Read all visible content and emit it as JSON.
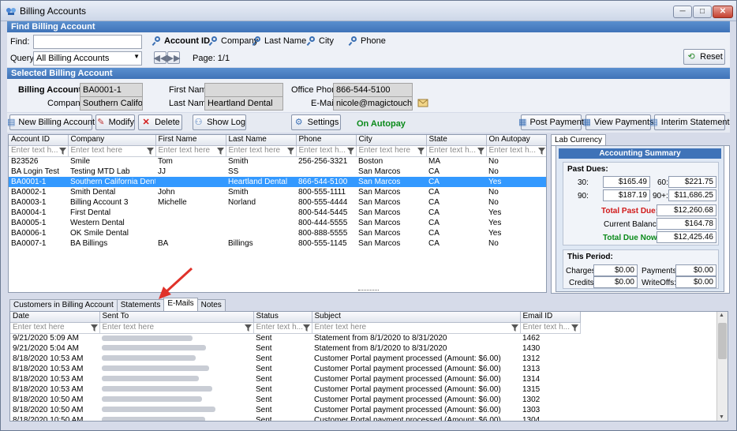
{
  "window": {
    "title": "Billing Accounts",
    "min": "─",
    "max": "□",
    "close": "✕"
  },
  "find": {
    "header": "Find Billing Account",
    "find_label": "Find:",
    "find_value": "",
    "radios": [
      "Account ID",
      "Company",
      "Last Name",
      "City",
      "Phone"
    ],
    "query_label": "Query:",
    "query_value": "All Billing Accounts",
    "page_label": "Page: 1/1",
    "reset": "Reset"
  },
  "selected": {
    "header": "Selected Billing Account",
    "id_label": "Billing Account ID:",
    "id": "BA0001-1",
    "company_label": "Company:",
    "company": "Southern California Dental Lab",
    "first_label": "First Name:",
    "first": "",
    "last_label": "Last Name:",
    "last": "Heartland Dental",
    "phone_label": "Office Phone:",
    "phone": "866-544-5100",
    "email_label": "E-Mail:",
    "email": "nicole@magictouchsoftware.com"
  },
  "toolbar": {
    "new": "New Billing Account",
    "modify": "Modify",
    "delete": "Delete",
    "showlog": "Show Log",
    "settings": "Settings",
    "autopay": "On Autopay",
    "post": "Post Payment",
    "view": "View Payments",
    "interim": "Interim Statement"
  },
  "accounts": {
    "columns": [
      "Account ID",
      "Company",
      "First Name",
      "Last Name",
      "Phone",
      "City",
      "State",
      "On Autopay"
    ],
    "filters": [
      "Enter text h...",
      "Enter text here",
      "Enter text here",
      "Enter text here",
      "Enter text h...",
      "Enter text here",
      "Enter text h...",
      "Enter text h..."
    ],
    "rows": [
      [
        "B23526",
        "Smile",
        "Tom",
        "Smith",
        "256-256-3321",
        "Boston",
        "MA",
        "No"
      ],
      [
        "BA Login Test",
        "Testing MTD Lab",
        "JJ",
        "SS",
        "",
        "San Marcos",
        "CA",
        "No"
      ],
      [
        "BA0001-1",
        "Southern California Dental...",
        "",
        "Heartland Dental",
        "866-544-5100",
        "San Marcos",
        "CA",
        "Yes"
      ],
      [
        "BA0002-1",
        "Smith Dental",
        "John",
        "Smith",
        "800-555-1111",
        "San Marcos",
        "CA",
        "No"
      ],
      [
        "BA0003-1",
        "Billing Account 3",
        "Michelle",
        "Norland",
        "800-555-4444",
        "San Marcos",
        "CA",
        "No"
      ],
      [
        "BA0004-1",
        "First Dental",
        "",
        "",
        "800-544-5445",
        "San Marcos",
        "CA",
        "Yes"
      ],
      [
        "BA0005-1",
        "Western Dental",
        "",
        "",
        "800-444-5555",
        "San Marcos",
        "CA",
        "Yes"
      ],
      [
        "BA0006-1",
        "OK Smile Dental",
        "",
        "",
        "800-888-5555",
        "San Marcos",
        "CA",
        "Yes"
      ],
      [
        "BA0007-1",
        "BA Billings",
        "BA",
        "Billings",
        "800-555-1145",
        "San Marcos",
        "CA",
        "No"
      ]
    ]
  },
  "side_tab": "Lab Currency",
  "summary": {
    "title": "Accounting Summary",
    "past_dues": "Past Dues:",
    "l30": "30:",
    "v30": "$165.49",
    "l60": "60:",
    "v60": "$221.75",
    "l90": "90:",
    "v90": "$187.19",
    "l90p": "90+:",
    "v90p": "$11,686.25",
    "total_past_label": "Total Past Due:",
    "total_past": "$12,260.68",
    "balance_label": "Current Balance:",
    "balance": "$164.78",
    "due_now_label": "Total Due Now:",
    "due_now": "$12,425.46",
    "period": "This Period:",
    "charges_label": "Charges:",
    "charges": "$0.00",
    "payments_label": "Payments:",
    "payments": "$0.00",
    "credits_label": "Credits:",
    "credits": "$0.00",
    "writeoffs_label": "WriteOffs:",
    "writeoffs": "$0.00"
  },
  "bottom_tabs": [
    "Customers in Billing Account",
    "Statements",
    "E-Mails",
    "Notes"
  ],
  "emails": {
    "columns": [
      "Date",
      "Sent To",
      "Status",
      "Subject",
      "Email ID"
    ],
    "filters": [
      "Enter text here",
      "Enter text here",
      "Enter text h...",
      "Enter text here",
      "Enter text h..."
    ],
    "rows": [
      [
        "9/21/2020 5:09 AM",
        "",
        "Sent",
        "Statement from 8/1/2020 to 8/31/2020",
        "1462"
      ],
      [
        "9/21/2020 5:04 AM",
        "",
        "Sent",
        "Statement from 8/1/2020 to 8/31/2020",
        "1430"
      ],
      [
        "8/18/2020 10:53 AM",
        "",
        "Sent",
        "Customer Portal payment processed (Amount: $6.00)",
        "1312"
      ],
      [
        "8/18/2020 10:53 AM",
        "",
        "Sent",
        "Customer Portal payment processed (Amount: $6.00)",
        "1313"
      ],
      [
        "8/18/2020 10:53 AM",
        "",
        "Sent",
        "Customer Portal payment processed (Amount: $6.00)",
        "1314"
      ],
      [
        "8/18/2020 10:53 AM",
        "",
        "Sent",
        "Customer Portal payment processed (Amount: $6.00)",
        "1315"
      ],
      [
        "8/18/2020 10:50 AM",
        "",
        "Sent",
        "Customer Portal payment processed (Amount: $6.00)",
        "1302"
      ],
      [
        "8/18/2020 10:50 AM",
        "",
        "Sent",
        "Customer Portal payment processed (Amount: $6.00)",
        "1303"
      ],
      [
        "8/18/2020 10:50 AM",
        "",
        "Sent",
        "Customer Portal payment processed (Amount: $6.00)",
        "1304"
      ]
    ]
  },
  "colors": {
    "header_blue": "#3f73b8",
    "selected_row": "#3399ff",
    "autopay_green": "#0a8a1a",
    "past_due_red": "#d11a1a",
    "arrow": "#e0322a"
  }
}
